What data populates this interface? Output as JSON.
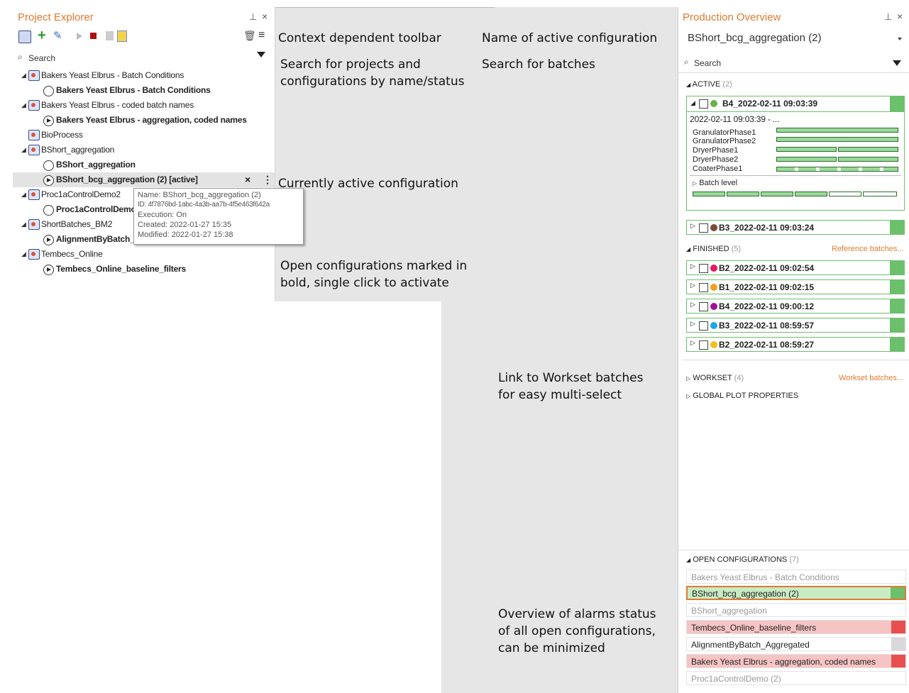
{
  "project_explorer": {
    "title": "Project Explorer",
    "search_placeholder": "Search",
    "tree": [
      {
        "type": "project",
        "label": "Bakers Yeast Elbrus - Batch Conditions"
      },
      {
        "type": "config",
        "label": "Bakers Yeast Elbrus - Batch Conditions",
        "open": true
      },
      {
        "type": "project",
        "label": "Bakers Yeast Elbrus - coded batch names"
      },
      {
        "type": "config",
        "label": "Bakers Yeast Elbrus - aggregation, coded names",
        "open": true
      },
      {
        "type": "project",
        "label": "BioProcess"
      },
      {
        "type": "project",
        "label": "BShort_aggregation"
      },
      {
        "type": "config",
        "label": "BShort_aggregation",
        "open": true
      },
      {
        "type": "config",
        "label": "BShort_bcg_aggregation (2) [active]",
        "open": true
      },
      {
        "type": "project",
        "label": "Proc1aControlDemo2"
      },
      {
        "type": "config",
        "label": "Proc1aControlDemo",
        "open": true
      },
      {
        "type": "project",
        "label": "ShortBatches_BM2"
      },
      {
        "type": "config",
        "label": "AlignmentByBatch_",
        "open": true
      },
      {
        "type": "project",
        "label": "Tembecs_Online"
      },
      {
        "type": "config",
        "label": "Tembecs_Online_baseline_filters",
        "open": true
      }
    ],
    "tooltip": {
      "name": "Name: BShort_bcg_aggregation (2)",
      "id": "ID: 4f7876bd-1abc-4a3b-aa7b-4f5e463f642a",
      "execution": "Execution: On",
      "created": "Created: 2022-01-27 15:35",
      "modified": "Modified: 2022-01-27 15:38"
    }
  },
  "annotations": {
    "toolbar": "Context dependent toolbar",
    "search_projects": "Search for projects and configurations by name/status",
    "search_projects_l1": "Search for projects and",
    "search_projects_l2": "configurations by name/status",
    "active_config": "Currently active configuration",
    "open_configs_l1": "Open configurations marked in",
    "open_configs_l2": "bold, single click to activate",
    "name_active": "Name of active configuration",
    "search_batches": "Search for batches",
    "workset_l1": "Link to Workset batches",
    "workset_l2": "for easy multi-select",
    "alarms_l1": "Overview of alarms status",
    "alarms_l2": "of all open configurations,",
    "alarms_l3": "can be minimized"
  },
  "production_overview": {
    "title": "Production Overview",
    "active_config": "BShort_bcg_aggregation (2)",
    "search_placeholder": "Search",
    "active_label": "ACTIVE",
    "active_count": "(2)",
    "active_batch": {
      "name": "B4_2022-02-11 09:03:39",
      "time": "2022-02-11 09:03:39 - ...",
      "phases": [
        "GranulatorPhase1",
        "GranulatorPhase2",
        "DryerPhase1",
        "DryerPhase2",
        "CoaterPhase1"
      ],
      "batch_level": "Batch level"
    },
    "active_batch2": "B3_2022-02-11 09:03:24",
    "finished_label": "FINISHED",
    "finished_count": "(5)",
    "reference_link": "Reference batches...",
    "finished": [
      {
        "name": "B2_2022-02-11 09:02:54",
        "color": "#e8195a"
      },
      {
        "name": "B1_2022-02-11 09:02:15",
        "color": "#f0a020"
      },
      {
        "name": "B4_2022-02-11 09:00:12",
        "color": "#a0139a"
      },
      {
        "name": "B3_2022-02-11 08:59:57",
        "color": "#1aa7e8"
      },
      {
        "name": "B2_2022-02-11 08:59:27",
        "color": "#f0c020"
      }
    ],
    "workset_label": "WORKSET",
    "workset_count": "(4)",
    "workset_link": "Workset batches...",
    "global_plot": "GLOBAL PLOT PROPERTIES",
    "open_configs_label": "OPEN CONFIGURATIONS",
    "open_configs_count": "(7)",
    "open_configs": [
      "Bakers Yeast Elbrus - Batch Conditions",
      "BShort_bcg_aggregation (2)",
      "BShort_aggregation",
      "Tembecs_Online_baseline_filters",
      "AlignmentByBatch_Aggregated",
      "Bakers Yeast Elbrus - aggregation, coded names",
      "Proc1aControlDemo (2)"
    ]
  }
}
